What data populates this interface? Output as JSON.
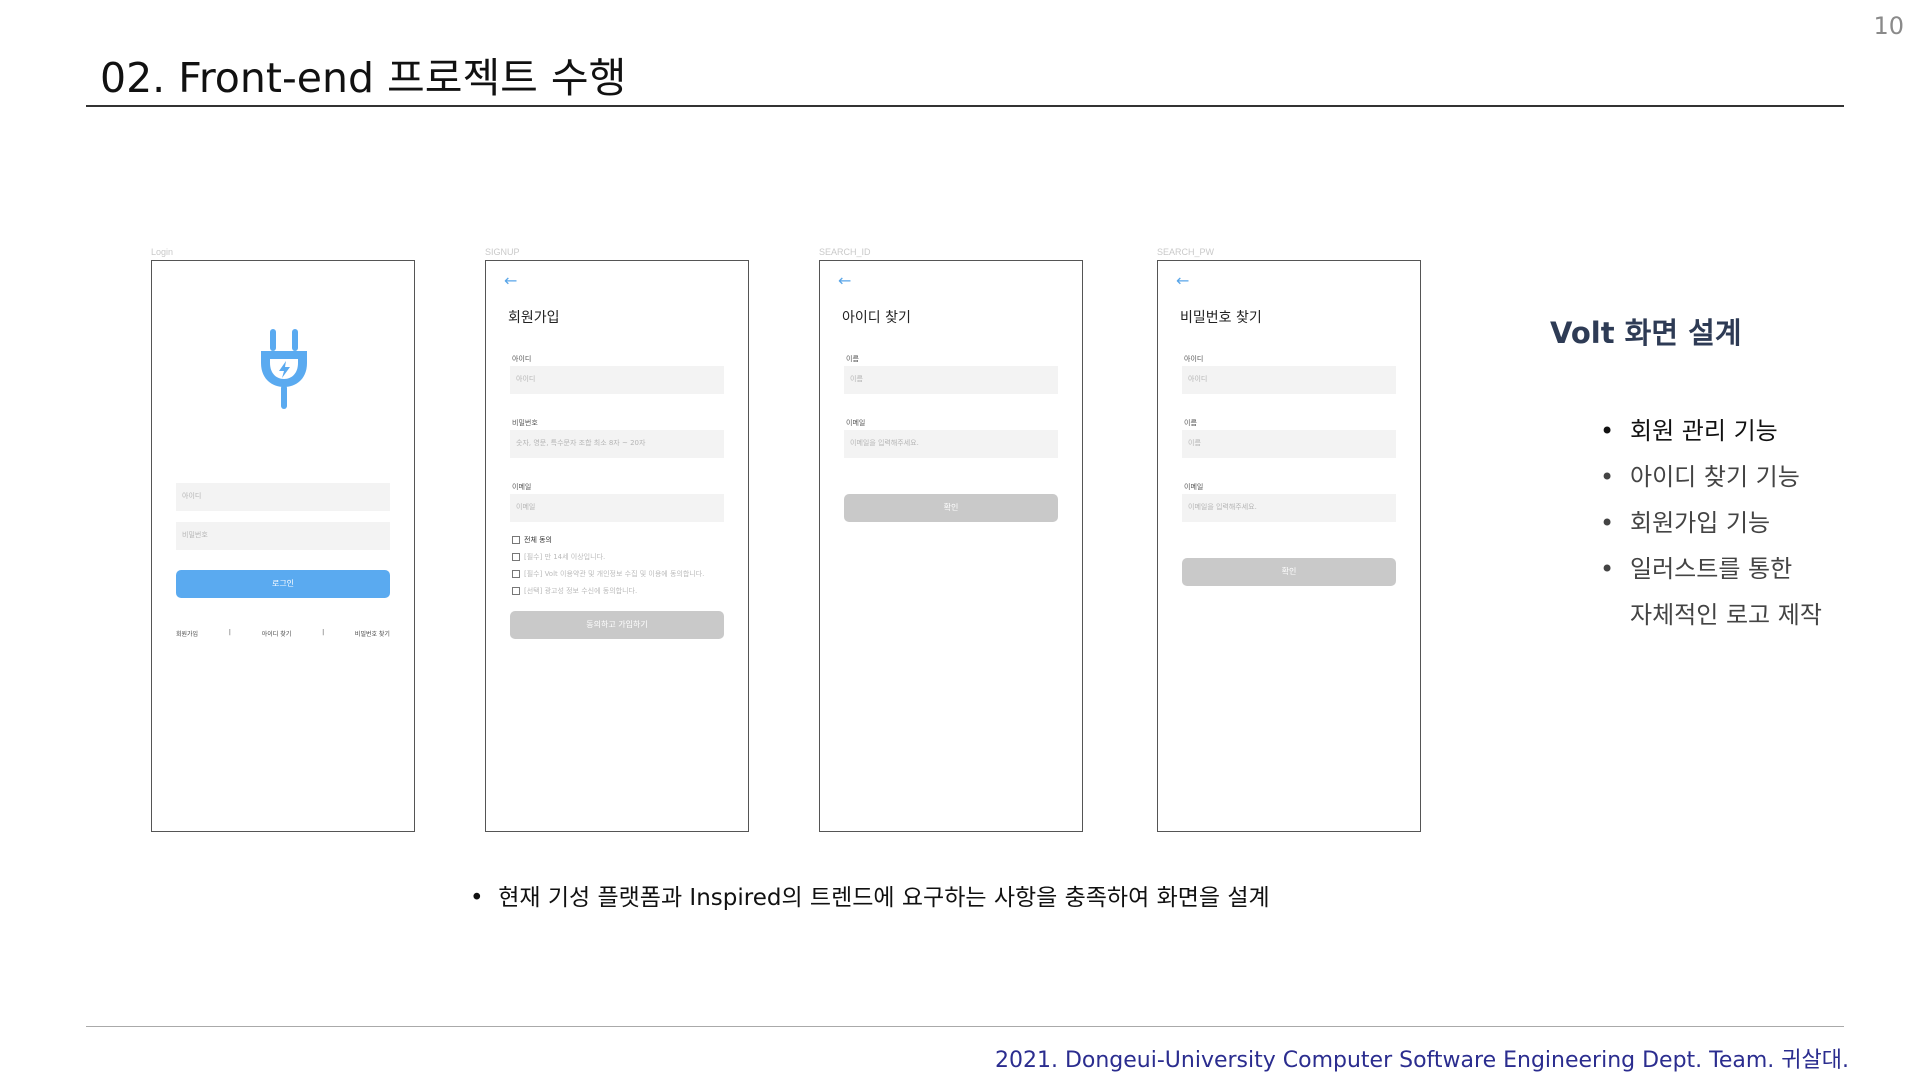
{
  "page_number": "10",
  "title": "02. Front-end 프로젝트 수행",
  "footer": "2021. Dongeui-University Computer Software Engineering Dept. Team. 귀살대.",
  "mockups": {
    "login": {
      "caption": "Login",
      "id_placeholder": "아이디",
      "pw_placeholder": "비밀번호",
      "login_button": "로그인",
      "links": [
        "회원가입",
        "|",
        "아이디 찾기",
        "|",
        "비밀번호 찾기"
      ]
    },
    "signup": {
      "caption": "SIGNUP",
      "back": "←",
      "title": "회원가입",
      "id_label": "아이디",
      "id_placeholder": "아이디",
      "pw_label": "비밀번호",
      "pw_placeholder": "숫자, 영문, 특수문자 조합 최소 8자 ~ 20자",
      "email_label": "이메일",
      "email_placeholder": "이메일",
      "agree_all": "전체 동의",
      "agree_items": [
        "[필수] 만 14세 이상입니다.",
        "[필수] Volt 이용약관 및 개인정보 수집 및 이용에 동의합니다.",
        "[선택] 광고성 정보 수신에 동의합니다."
      ],
      "submit": "동의하고 가입하기"
    },
    "search_id": {
      "caption": "SEARCH_ID",
      "back": "←",
      "title": "아이디 찾기",
      "name_label": "이름",
      "name_placeholder": "이름",
      "email_label": "이메일",
      "email_placeholder": "이메일을 입력해주세요.",
      "confirm": "확인"
    },
    "search_pw": {
      "caption": "SEARCH_PW",
      "back": "←",
      "title": "비밀번호 찾기",
      "id_label": "아이디",
      "id_placeholder": "아이디",
      "name_label": "이름",
      "name_placeholder": "이름",
      "email_label": "이메일",
      "email_placeholder": "이메일을 입력해주세요.",
      "confirm": "확인"
    }
  },
  "side": {
    "title": "Volt 화면 설계",
    "bullets": [
      "회원 관리 기능",
      "아이디 찾기 기능",
      "회원가입 기능",
      "일러스트를 통한",
      "자체적인 로고 제작"
    ]
  },
  "bottom_note": "현재 기성 플랫폼과 Inspired의 트렌드에 요구하는 사항을 충족하여 화면을 설계",
  "colors": {
    "accent": "#5aaaf0",
    "footer": "#2b2d8f",
    "side_title": "#2e3b55"
  }
}
